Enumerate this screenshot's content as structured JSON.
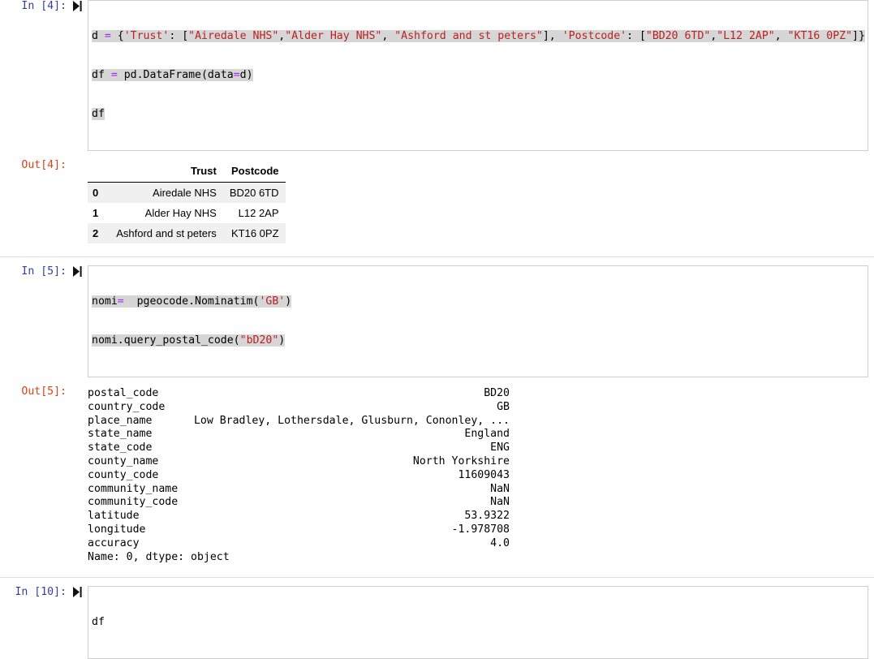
{
  "notebook": {
    "run_icon_name": "run-cell-icon",
    "cells": [
      {
        "id": "cell-4",
        "in_prompt": "In [4]:",
        "out_prompt": "Out[4]:",
        "code_lines": [
          [
            {
              "t": "d ",
              "c": "plain"
            },
            {
              "t": "=",
              "c": "op"
            },
            {
              "t": " {",
              "c": "plain"
            },
            {
              "t": "'Trust'",
              "c": "str"
            },
            {
              "t": ": [",
              "c": "plain"
            },
            {
              "t": "\"Airedale NHS\"",
              "c": "str"
            },
            {
              "t": ",",
              "c": "plain"
            },
            {
              "t": "\"Alder Hay NHS\"",
              "c": "str"
            },
            {
              "t": ", ",
              "c": "plain"
            },
            {
              "t": "\"Ashford and st peters\"",
              "c": "str"
            },
            {
              "t": "], ",
              "c": "plain"
            },
            {
              "t": "'Postcode'",
              "c": "str"
            },
            {
              "t": ": [",
              "c": "plain"
            },
            {
              "t": "\"BD20 6TD\"",
              "c": "str"
            },
            {
              "t": ",",
              "c": "plain"
            },
            {
              "t": "\"L12 2AP\"",
              "c": "str"
            },
            {
              "t": ", ",
              "c": "plain"
            },
            {
              "t": "\"KT16 0PZ\"",
              "c": "str"
            },
            {
              "t": "]}",
              "c": "plain"
            }
          ],
          [
            {
              "t": "df ",
              "c": "plain"
            },
            {
              "t": "=",
              "c": "op"
            },
            {
              "t": " pd.DataFrame(data",
              "c": "plain"
            },
            {
              "t": "=",
              "c": "op"
            },
            {
              "t": "d)",
              "c": "plain"
            }
          ],
          [
            {
              "t": "df",
              "c": "plain"
            }
          ]
        ],
        "output": {
          "kind": "dataframe",
          "columns": [
            "Trust",
            "Postcode"
          ],
          "index": [
            "0",
            "1",
            "2"
          ],
          "rows": [
            [
              "Airedale NHS",
              "BD20 6TD"
            ],
            [
              "Alder Hay NHS",
              "L12 2AP"
            ],
            [
              "Ashford and st peters",
              "KT16 0PZ"
            ]
          ]
        }
      },
      {
        "id": "cell-5",
        "in_prompt": "In [5]:",
        "out_prompt": "Out[5]:",
        "code_lines": [
          [
            {
              "t": "nomi",
              "c": "plain"
            },
            {
              "t": "=",
              "c": "op"
            },
            {
              "t": "  pgeocode.Nominatim(",
              "c": "plain"
            },
            {
              "t": "'GB'",
              "c": "str"
            },
            {
              "t": ")",
              "c": "plain"
            }
          ],
          [
            {
              "t": "nomi.query_postal_code(",
              "c": "plain"
            },
            {
              "t": "\"bD20\"",
              "c": "str"
            },
            {
              "t": ")",
              "c": "plain"
            }
          ]
        ],
        "output": {
          "kind": "series",
          "entries": [
            {
              "key": "postal_code",
              "value": "BD20"
            },
            {
              "key": "country_code",
              "value": "GB"
            },
            {
              "key": "place_name",
              "value": "Low Bradley, Lothersdale, Glusburn, Cononley, ..."
            },
            {
              "key": "state_name",
              "value": "England"
            },
            {
              "key": "state_code",
              "value": "ENG"
            },
            {
              "key": "county_name",
              "value": "North Yorkshire"
            },
            {
              "key": "county_code",
              "value": "11609043"
            },
            {
              "key": "community_name",
              "value": "NaN"
            },
            {
              "key": "community_code",
              "value": "NaN"
            },
            {
              "key": "latitude",
              "value": "53.9322"
            },
            {
              "key": "longitude",
              "value": "-1.978708"
            },
            {
              "key": "accuracy",
              "value": "4.0"
            }
          ],
          "footer": "Name: 0, dtype: object"
        }
      },
      {
        "id": "cell-10",
        "in_prompt": "In [10]:",
        "code_lines": [
          [
            {
              "t": "df",
              "c": "plain"
            }
          ]
        ]
      }
    ]
  }
}
